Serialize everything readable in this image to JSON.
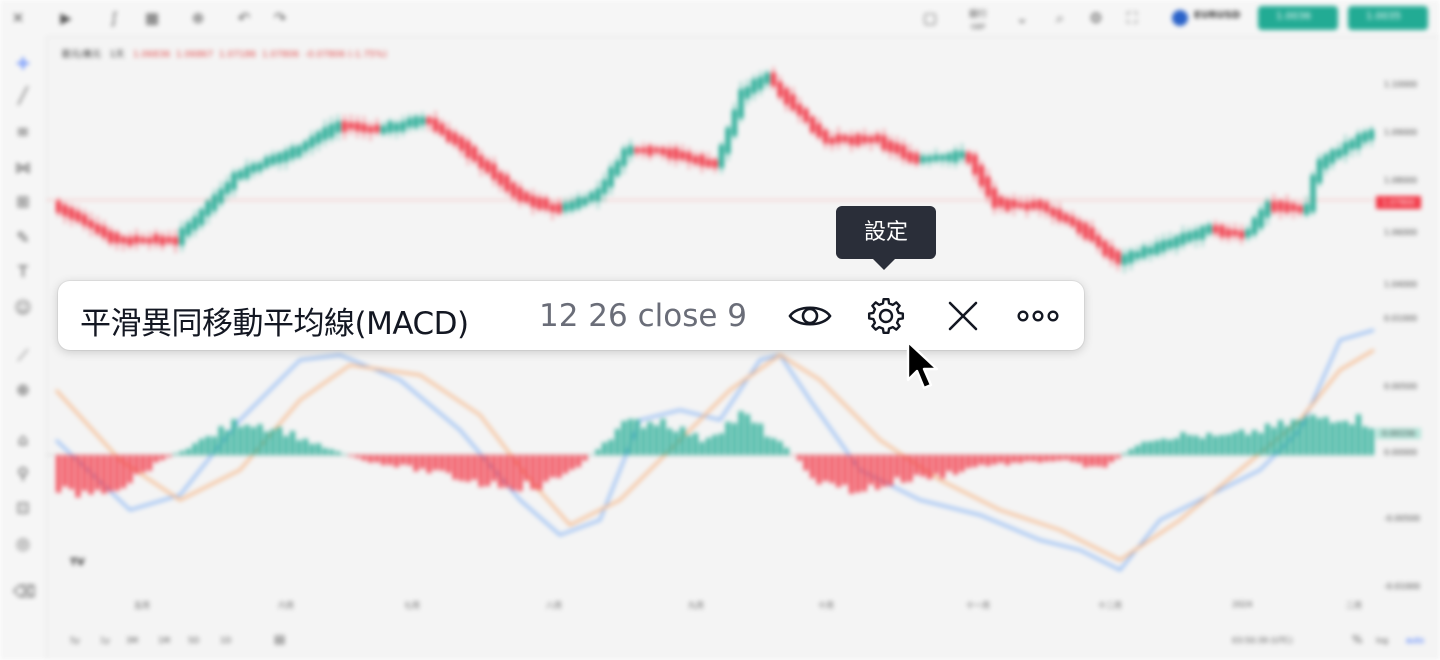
{
  "header": {
    "symbol": "EURUSD",
    "interval_label": "銀行",
    "interval_sub": "GBP",
    "buy_label": "1.0035",
    "sell_label": "1.0036"
  },
  "legend": {
    "symbol": "歐元/美元",
    "interval": "1天",
    "open": "1.06836",
    "high": "1.06867",
    "low": "1.07186",
    "close": "1.07806",
    "change": "-0.07806 (-1.75%)"
  },
  "price_axis": {
    "main": [
      "1.10000",
      "1.09000",
      "1.08000",
      "1.07800",
      "1.06000",
      "1.04000"
    ],
    "macd": [
      "0.01000",
      "0.00500",
      "0.00000",
      "-0.00500",
      "-0.01000"
    ],
    "current_price": "1.07800",
    "current_macd": "0.00156"
  },
  "time_axis": [
    "五月",
    "六月",
    "七月",
    "八月",
    "九月",
    "十月",
    "十一月",
    "十二月",
    "2024",
    "二月"
  ],
  "bottombar": {
    "ranges": [
      "5y",
      "1y",
      "3M",
      "1M",
      "5D",
      "1D"
    ],
    "clock": "03:50:39 (UTC)",
    "log": "log",
    "auto": "auto"
  },
  "logo_text": "TV",
  "indicator_pill": {
    "title": "平滑異同移動平均線(MACD)",
    "params": "12 26 close 9",
    "show_label": "visibility",
    "settings_label": "settings",
    "remove_label": "remove",
    "more_label": "more"
  },
  "tooltip": {
    "text": "設定"
  },
  "colors": {
    "up": "#22ab94",
    "down": "#f23645",
    "macd_line": "#2962ff",
    "signal_line": "#ff6d00",
    "tooltip_bg": "#2a2e39"
  }
}
